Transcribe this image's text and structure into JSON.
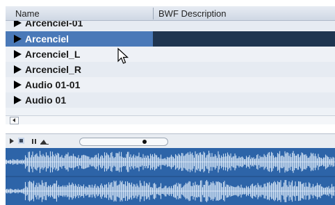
{
  "header": {
    "col_name": "Name",
    "col_bwf": "BWF Description"
  },
  "rows": [
    {
      "label": "Arcenciel-01",
      "selected": false
    },
    {
      "label": "Arcenciel",
      "selected": true
    },
    {
      "label": "Arcenciel_L",
      "selected": false
    },
    {
      "label": "Arcenciel_R",
      "selected": false
    },
    {
      "label": "Audio 01-01",
      "selected": false
    },
    {
      "label": "Audio 01",
      "selected": false
    }
  ],
  "player": {
    "position": 0.76
  },
  "icons": {
    "expand": "triangle-right-icon",
    "scroll_left": "chevron-left-icon",
    "play": "play-icon",
    "stop": "stop-icon",
    "pause": "pause-icon",
    "loop": "loop-icon",
    "cursor": "mouse-pointer-icon"
  }
}
